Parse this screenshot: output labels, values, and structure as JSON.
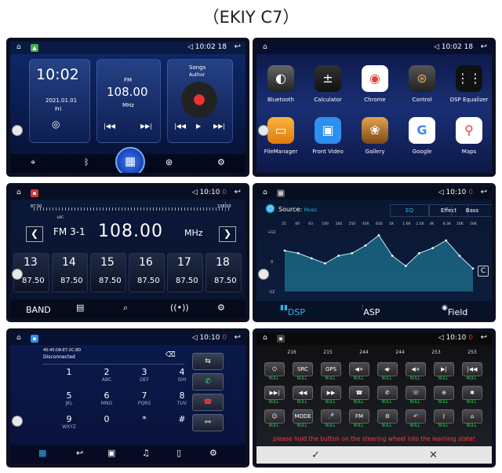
{
  "title": "（EKIY C7）",
  "p1": {
    "time": "10:02",
    "signal": "18",
    "clock": "10:02",
    "date": "2021.01.01",
    "weekday": "Fri",
    "radio_band": "FM",
    "radio_freq": "108.00",
    "radio_unit": "MHz",
    "music_title": "Songs",
    "music_artist": "Author",
    "dock_icons": [
      "gps-icon",
      "bluetooth-icon",
      "apps-icon",
      "steering-icon",
      "settings-icon"
    ]
  },
  "p2": {
    "time": "10:02",
    "signal": "18",
    "apps": [
      "Bluetooth",
      "Calculator",
      "Chrome",
      "Control",
      "DSP Equalizer",
      "FileManager",
      "Front Video",
      "Gallery",
      "Google",
      "Maps"
    ]
  },
  "p3": {
    "time": "10:10",
    "signal": "0",
    "scale_left": "87.50",
    "scale_right": "108.00",
    "loc": "LOC",
    "band": "FM 3-1",
    "freq": "108.00",
    "unit": "MHz",
    "presets": [
      {
        "num": "13",
        "val": "87.50"
      },
      {
        "num": "14",
        "val": "87.50"
      },
      {
        "num": "15",
        "val": "87.50"
      },
      {
        "num": "16",
        "val": "87.50"
      },
      {
        "num": "17",
        "val": "87.50"
      },
      {
        "num": "18",
        "val": "87.50"
      }
    ],
    "band_label": "BAND"
  },
  "p4": {
    "time": "10:10",
    "signal": "0",
    "source_label": "Source:",
    "source_value": "Music",
    "tabs": [
      "EQ",
      "Effect",
      "Bass"
    ],
    "freqs": [
      "25",
      "40",
      "63",
      "100",
      "160",
      "250",
      "400",
      "630",
      "1K",
      "1.6K",
      "2.5K",
      "4K",
      "6.3K",
      "10K",
      "16K"
    ],
    "y_top": "+12",
    "y_mid": "0",
    "y_bot": "-12",
    "bottom": [
      "DSP",
      "ASP",
      "Field"
    ],
    "levels": [
      4,
      3,
      1,
      -1,
      2,
      3,
      6,
      10,
      2,
      -2,
      3,
      5,
      8,
      2,
      -3
    ]
  },
  "p5": {
    "time": "10:10",
    "signal": "0",
    "device_id": "40:45:DA:E7:2C:8D",
    "status": "Disconnected",
    "keys": [
      {
        "d": "1",
        "l": ""
      },
      {
        "d": "2",
        "l": "ABC"
      },
      {
        "d": "3",
        "l": "DEF"
      },
      {
        "d": "4",
        "l": "GHI"
      },
      {
        "d": "5",
        "l": "JKL"
      },
      {
        "d": "6",
        "l": "MNO"
      },
      {
        "d": "7",
        "l": "PQRS"
      },
      {
        "d": "8",
        "l": "TUV"
      },
      {
        "d": "9",
        "l": "WXYZ"
      },
      {
        "d": "0",
        "l": ""
      },
      {
        "d": "*",
        "l": ""
      },
      {
        "d": "#",
        "l": ""
      }
    ]
  },
  "p6": {
    "time": "10:10",
    "signal": "0",
    "values": [
      "216",
      "215",
      "244",
      "244",
      "253",
      "253"
    ],
    "null": "NULL",
    "row1": [
      "⏻",
      "SRC",
      "GPS",
      "◀+",
      "◀-",
      "◀×",
      "▶|",
      "|◀◀"
    ],
    "row2": [
      "▶▶|",
      "◀◀",
      "▶▶",
      "☎",
      "✆",
      "☏",
      "⊕",
      "✱"
    ],
    "row3": [
      "☺",
      "MODE",
      "🎤",
      "FM",
      "⚙",
      "↶",
      "ᛒ",
      "⌂"
    ],
    "warning": "please hold the button on the steering wheel into the learning state!",
    "confirm": "✓",
    "cancel": "✕"
  }
}
